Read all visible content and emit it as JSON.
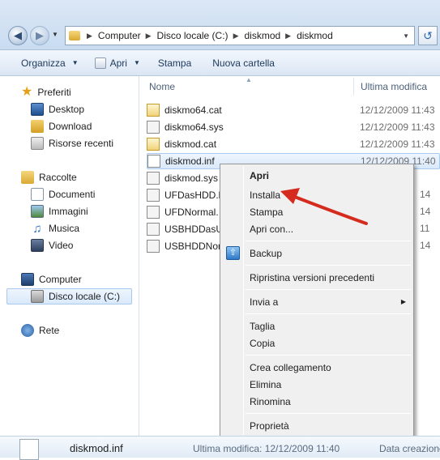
{
  "address": {
    "crumbs": [
      "Computer",
      "Disco locale (C:)",
      "diskmod",
      "diskmod"
    ]
  },
  "toolbar": {
    "organize": "Organizza",
    "open": "Apri",
    "print": "Stampa",
    "new_folder": "Nuova cartella"
  },
  "nav": {
    "favorites": {
      "label": "Preferiti",
      "items": [
        "Desktop",
        "Download",
        "Risorse recenti"
      ]
    },
    "libraries": {
      "label": "Raccolte",
      "items": [
        "Documenti",
        "Immagini",
        "Musica",
        "Video"
      ]
    },
    "computer": {
      "label": "Computer",
      "items": [
        "Disco locale (C:)"
      ]
    },
    "network": {
      "label": "Rete"
    }
  },
  "columns": {
    "name": "Nome",
    "modified": "Ultima modifica"
  },
  "files": [
    {
      "name": "diskmo64.cat",
      "date": "12/12/2009 11:43",
      "icon": "catalog-icon"
    },
    {
      "name": "diskmo64.sys",
      "date": "12/12/2009 11:43",
      "icon": "system-file-icon"
    },
    {
      "name": "diskmod.cat",
      "date": "12/12/2009 11:43",
      "icon": "catalog-icon"
    },
    {
      "name": "diskmod.inf",
      "date": "12/12/2009 11:40",
      "icon": "setup-info-icon"
    },
    {
      "name": "diskmod.sys",
      "date": "",
      "icon": "system-file-icon"
    },
    {
      "name": "UFDasHDD.b",
      "date": "",
      "icon": "system-file-icon"
    },
    {
      "name": "UFDNormal.",
      "date": "",
      "icon": "system-file-icon"
    },
    {
      "name": "USBHDDasUl",
      "date": "",
      "icon": "system-file-icon"
    },
    {
      "name": "USBHDDNor",
      "date": "",
      "icon": "system-file-icon"
    }
  ],
  "partial_dates": [
    "14",
    "14",
    "11",
    "14"
  ],
  "context_menu": {
    "items": [
      "Apri",
      "Installa",
      "Stampa",
      "Apri con...",
      "Backup",
      "Ripristina versioni precedenti",
      "Invia a",
      "Taglia",
      "Copia",
      "Crea collegamento",
      "Elimina",
      "Rinomina",
      "Proprietà"
    ]
  },
  "status": {
    "filename": "diskmod.inf",
    "modified": "Ultima modifica: 12/12/2009 11:40",
    "created_label": "Data creazione"
  },
  "colors": {
    "arrow": "#d52b1e",
    "selection": "#d9e9fb"
  }
}
